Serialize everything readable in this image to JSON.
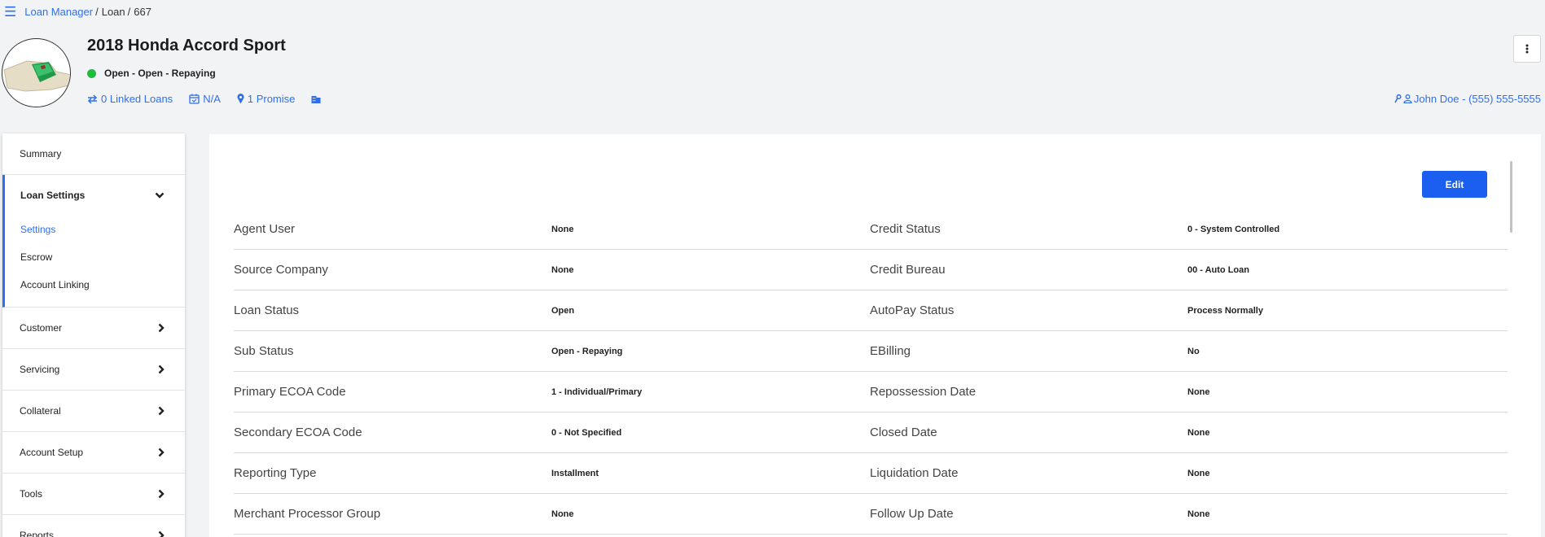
{
  "breadcrumb": {
    "root": "Loan Manager",
    "section": "Loan",
    "id": "667"
  },
  "loan": {
    "title": "2018 Honda Accord Sport",
    "status": "Open - Open - Repaying",
    "status_color": "#1fbd3e",
    "linked_loans": "0 Linked Loans",
    "date": "N/A",
    "promise": "1 Promise",
    "contact": "John Doe - (555) 555-5555"
  },
  "sidebar": {
    "summary": "Summary",
    "loan_settings": "Loan Settings",
    "sub": [
      "Settings",
      "Escrow",
      "Account Linking"
    ],
    "items": [
      "Customer",
      "Servicing",
      "Collateral",
      "Account Setup",
      "Tools",
      "Reports"
    ]
  },
  "panel": {
    "edit_label": "Edit",
    "rows": [
      {
        "left_label": "Agent User",
        "left_value": "None",
        "right_label": "Credit Status",
        "right_value": "0 - System Controlled"
      },
      {
        "left_label": "Source Company",
        "left_value": "None",
        "right_label": "Credit Bureau",
        "right_value": "00 - Auto Loan"
      },
      {
        "left_label": "Loan Status",
        "left_value": "Open",
        "right_label": "AutoPay Status",
        "right_value": "Process Normally"
      },
      {
        "left_label": "Sub Status",
        "left_value": "Open - Repaying",
        "right_label": "EBilling",
        "right_value": "No"
      },
      {
        "left_label": "Primary ECOA Code",
        "left_value": "1 - Individual/Primary",
        "right_label": "Repossession Date",
        "right_value": "None"
      },
      {
        "left_label": "Secondary ECOA Code",
        "left_value": "0 - Not Specified",
        "right_label": "Closed Date",
        "right_value": "None"
      },
      {
        "left_label": "Reporting Type",
        "left_value": "Installment",
        "right_label": "Liquidation Date",
        "right_value": "None"
      },
      {
        "left_label": "Merchant Processor Group",
        "left_value": "None",
        "right_label": "Follow Up Date",
        "right_value": "None"
      }
    ]
  },
  "colors": {
    "accent": "#2f6fed",
    "button": "#1a5ff0"
  }
}
